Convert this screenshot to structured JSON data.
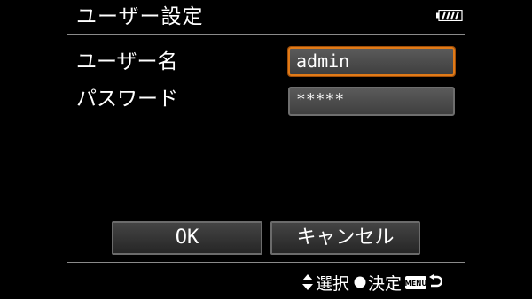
{
  "header": {
    "title": "ユーザー設定",
    "battery_icon": "battery-full-icon"
  },
  "form": {
    "username_label": "ユーザー名",
    "username_value": "admin",
    "password_label": "パスワード",
    "password_value": "*****"
  },
  "buttons": {
    "ok_label": "OK",
    "cancel_label": "キャンセル"
  },
  "footer": {
    "select_icon": "up-down-arrows-icon",
    "select_label": "選択",
    "confirm_icon": "filled-circle-icon",
    "confirm_label": "決定",
    "menu_icon_text": "MENU",
    "back_icon": "return-arrow-icon"
  },
  "colors": {
    "background": "#000000",
    "focus_border": "#e07a18",
    "text": "#ffffff"
  }
}
